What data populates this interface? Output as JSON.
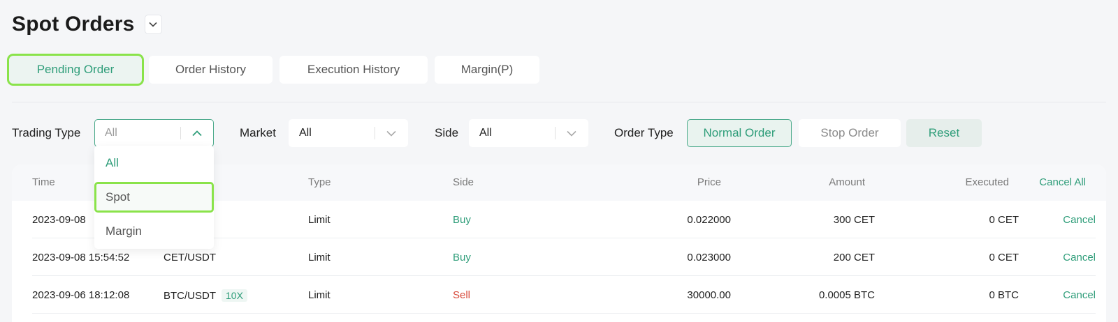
{
  "page": {
    "title": "Spot Orders"
  },
  "tabs": [
    {
      "label": "Pending Order",
      "active": true
    },
    {
      "label": "Order History",
      "active": false
    },
    {
      "label": "Execution History",
      "active": false
    },
    {
      "label": "Margin(P)",
      "active": false
    }
  ],
  "filters": {
    "trading_type": {
      "label": "Trading Type",
      "value": "All",
      "open": true,
      "options": [
        "All",
        "Spot",
        "Margin"
      ],
      "selected": "All",
      "highlighted": "Spot"
    },
    "market": {
      "label": "Market",
      "value": "All"
    },
    "side": {
      "label": "Side",
      "value": "All"
    },
    "order_type": {
      "label": "Order Type",
      "normal": "Normal Order",
      "stop": "Stop Order",
      "selected": "Normal Order"
    },
    "reset_label": "Reset"
  },
  "table": {
    "headers": {
      "time": "Time",
      "type": "Type",
      "side": "Side",
      "price": "Price",
      "amount": "Amount",
      "executed": "Executed",
      "cancel_all": "Cancel All"
    },
    "rows": [
      {
        "time": "2023-09-08",
        "market": "",
        "leverage": "",
        "type": "Limit",
        "side": "Buy",
        "price": "0.022000",
        "amount": "300 CET",
        "executed": "0 CET",
        "action": "Cancel"
      },
      {
        "time": "2023-09-08 15:54:52",
        "market": "CET/USDT",
        "leverage": "",
        "type": "Limit",
        "side": "Buy",
        "price": "0.023000",
        "amount": "200 CET",
        "executed": "0 CET",
        "action": "Cancel"
      },
      {
        "time": "2023-09-06 18:12:08",
        "market": "BTC/USDT",
        "leverage": "10X",
        "type": "Limit",
        "side": "Sell",
        "price": "30000.00",
        "amount": "0.0005 BTC",
        "executed": "0 BTC",
        "action": "Cancel"
      }
    ]
  },
  "colors": {
    "accent": "#2e9d79",
    "sell": "#d8493a",
    "highlight": "#8ae34a"
  },
  "icons": {
    "title_toggle": "chevron-down-icon",
    "select_open": "chevron-up-icon",
    "select_closed": "chevron-down-icon"
  }
}
